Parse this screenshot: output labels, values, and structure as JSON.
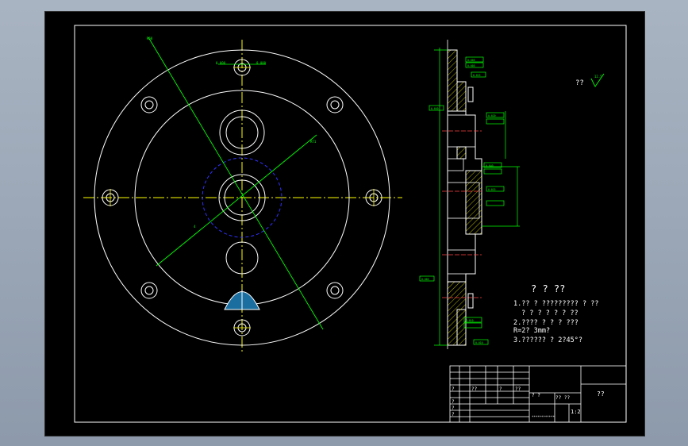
{
  "roughness": {
    "label": "??",
    "value": "12.5"
  },
  "notes": {
    "title": "? ? ??",
    "line1": "1.??  ? ?????????      ? ??",
    "line2": "? ? ? ? ? ? ??",
    "line3": "2.????      ? ? ? ???",
    "line4": "R=2? 3mm?",
    "line5": "3.??????       ? 2?45°?"
  },
  "title_block": {
    "name": "??",
    "scale": "1:2",
    "row_labels": [
      "?",
      "?",
      "?",
      "?"
    ],
    "header_cells": [
      "??",
      "?",
      "??"
    ],
    "mid_cells": [
      "? ?",
      "?? ??"
    ],
    "bottom_text": "************"
  },
  "plan_dims": [
    "0.000",
    "0.000",
    "R68",
    "R71",
    "4"
  ],
  "section_dims": [
    "0.005",
    "0.005",
    "0.015",
    "0.040",
    "0.020",
    "0.040",
    "0.015",
    "0.005",
    "0.010",
    "0.010"
  ]
}
